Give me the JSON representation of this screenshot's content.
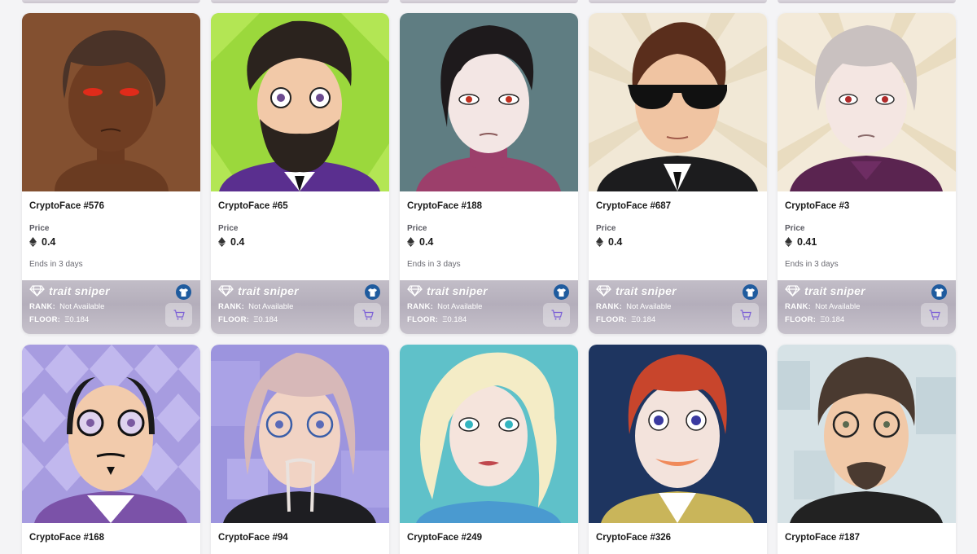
{
  "labels": {
    "price": "Price",
    "rank_key": "RANK:",
    "floor_key": "FLOOR:",
    "brand": "trait sniper"
  },
  "cards_row1": [
    {
      "name": "CryptoFace #576",
      "price": "0.4",
      "ends": "Ends in 3 days",
      "rank": "Not Available",
      "floor": "Ξ0.184"
    },
    {
      "name": "CryptoFace #65",
      "price": "0.4",
      "ends": "",
      "rank": "Not Available",
      "floor": "Ξ0.184"
    },
    {
      "name": "CryptoFace #188",
      "price": "0.4",
      "ends": "Ends in 3 days",
      "rank": "Not Available",
      "floor": "Ξ0.184"
    },
    {
      "name": "CryptoFace #687",
      "price": "0.4",
      "ends": "",
      "rank": "Not Available",
      "floor": "Ξ0.184"
    },
    {
      "name": "CryptoFace #3",
      "price": "0.41",
      "ends": "Ends in 3 days",
      "rank": "Not Available",
      "floor": "Ξ0.184"
    }
  ],
  "cards_row2": [
    {
      "name": "CryptoFace #168"
    },
    {
      "name": "CryptoFace #94"
    },
    {
      "name": "CryptoFace #249"
    },
    {
      "name": "CryptoFace #326"
    },
    {
      "name": "CryptoFace #187"
    }
  ],
  "colors": {
    "accent_shirt": "#1f5b9e",
    "cart_icon": "#7b5fd6",
    "sniper_band": "#b4aebb"
  }
}
